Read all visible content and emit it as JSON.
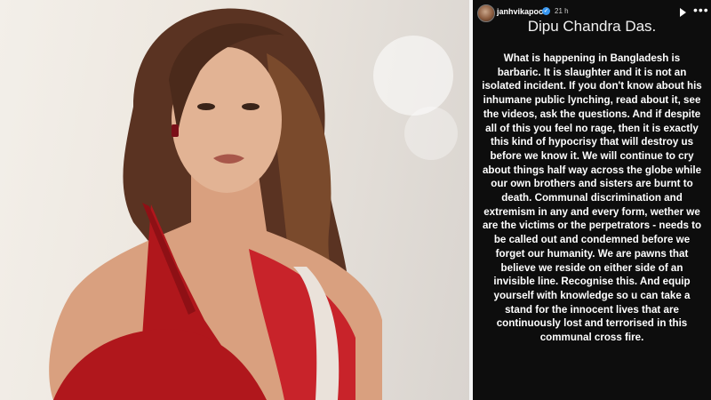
{
  "story": {
    "username": "janhvikapoor",
    "time": "21 h",
    "title": "Dipu Chandra Das.",
    "body": "What is happening in Bangladesh is barbaric. It is slaughter and it is not an isolated incident. If you don't know about his inhumane public lynching, read about it, see the videos, ask the questions. And if despite all of this you feel no rage, then it is exactly this kind of hypocrisy that will destroy us before we know it. We will continue to cry about things half way across the globe while our own brothers and sisters are burnt to death. Communal discrimination and extremism in any and every form, wether we are the victims or the perpetrators - needs to be called out and condemned before we forget our humanity. We are pawns that believe we reside on either side of an invisible line. Recognise this. And equip yourself with knowledge so u can take a stand for the innocent lives that are continuously lost and terrorised in this communal cross fire."
  },
  "icons": {
    "avatar": "profile-avatar",
    "verified": "verified-badge-icon",
    "play": "play-icon",
    "more": "more-options-icon"
  },
  "colors": {
    "story_background": "#0d0d0d",
    "saree_red": "#b0171c",
    "verified_blue": "#3897f0"
  }
}
